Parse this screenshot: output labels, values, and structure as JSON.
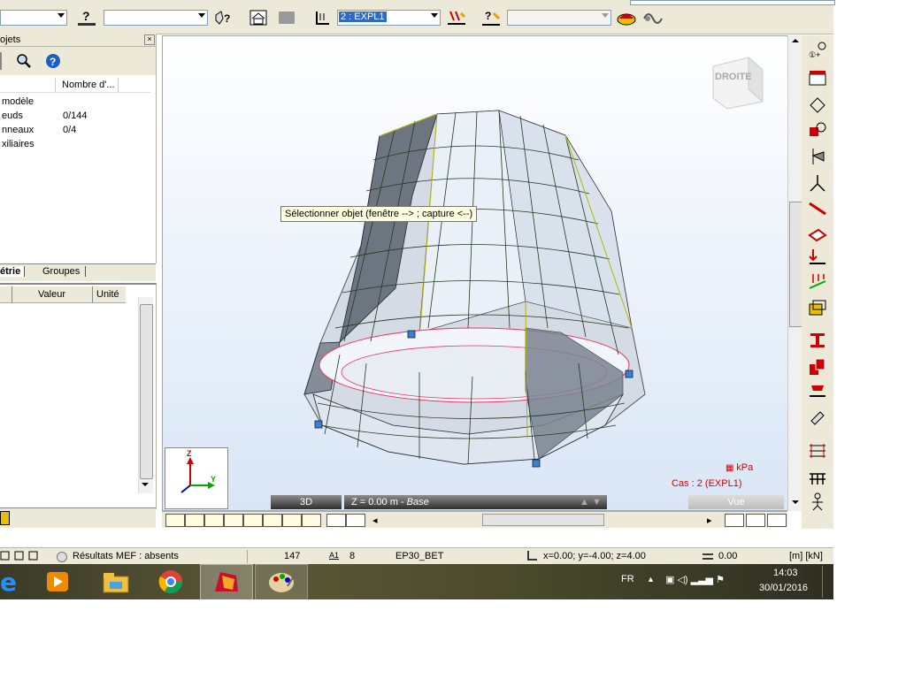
{
  "toolbar": {
    "combo_left_value": "",
    "combo_mid_value": "",
    "load_case_value": "2 : EXPL1",
    "combo_right_value": ""
  },
  "left_panel": {
    "title": "ojets",
    "column_nombre": "Nombre d'...",
    "rows": [
      {
        "label": "modèle",
        "value": ""
      },
      {
        "label": "euds",
        "value": "0/144"
      },
      {
        "label": "nneaux",
        "value": "0/4"
      },
      {
        "label": "xiliaires",
        "value": ""
      }
    ],
    "tabs": [
      "étrie",
      "Groupes"
    ],
    "props_columns": [
      "Valeur",
      "Unité"
    ]
  },
  "viewport": {
    "view_cube_label": "DROITE",
    "tooltip": "Sélectionner objet (fenêtre --> ; capture <--)",
    "unit_label": "kPa",
    "case_label": "Cas : 2 (EXPL1)",
    "mode_label": "3D",
    "level_label": "Z = 0.00 m - ",
    "level_name": "Base",
    "vue_label": "Vue",
    "axis_z": "Z",
    "axis_y": "Y"
  },
  "statusbar": {
    "results": "Résultats MEF : absents",
    "count": "147",
    "section_value": "8",
    "material": "EP30_BET",
    "coords": "x=0.00; y=-4.00; z=4.00",
    "angle": "0.00",
    "units": "[m] [kN]"
  },
  "taskbar": {
    "lang": "FR",
    "time": "14:03",
    "date": "30/01/2016"
  }
}
